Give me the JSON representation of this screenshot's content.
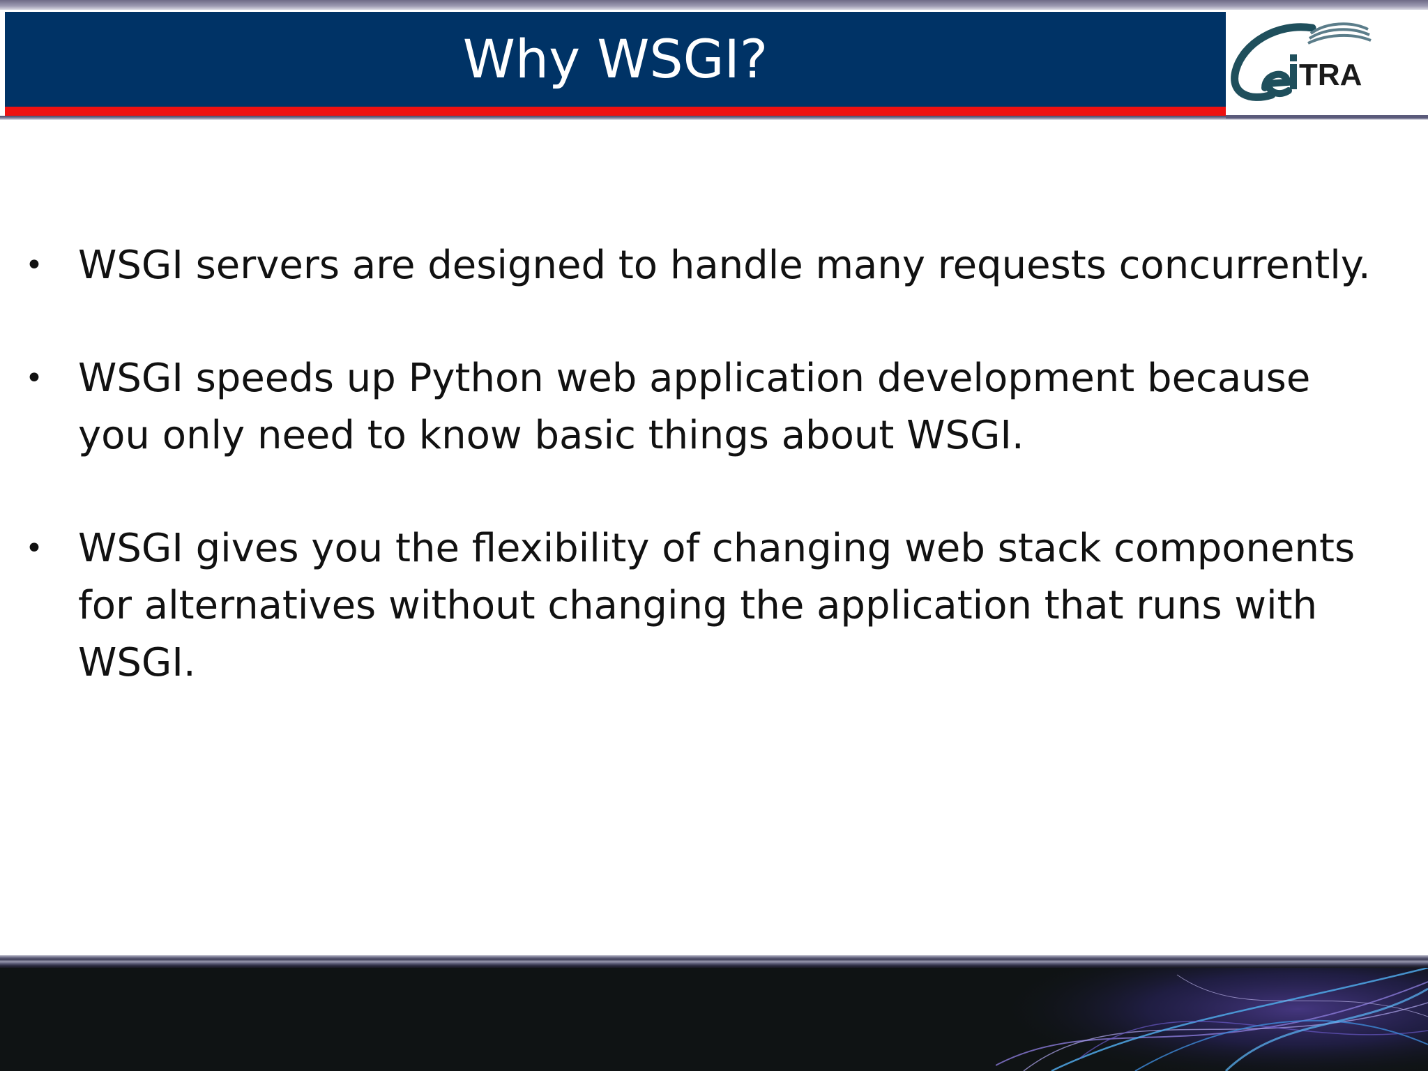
{
  "slide": {
    "title": "Why WSGI?",
    "bullets": [
      {
        "text": "WSGI servers are designed to handle many requests concurrently."
      },
      {
        "text": "WSGI speeds up Python web application development because you only need to know basic things about WSGI."
      },
      {
        "text": "WSGI gives you the flexibility of changing web stack components for alternatives without changing the application that runs with WSGI."
      }
    ],
    "bullet_glyph": "•"
  },
  "logo": {
    "text": "eiTRA",
    "icon": "eitra-logo-icon"
  },
  "colors": {
    "title_bar": "#003366",
    "title_accent": "#ee1111",
    "footer": "#0f1314",
    "logo_teal": "#1f4f5c"
  }
}
